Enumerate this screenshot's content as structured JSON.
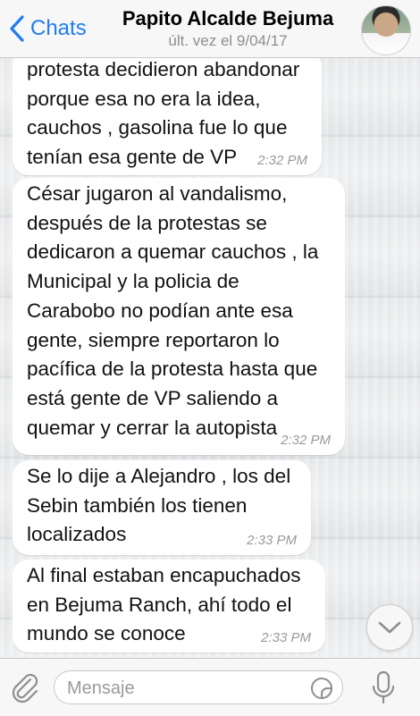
{
  "header": {
    "back_label": "Chats",
    "title": "Papito Alcalde Bejuma",
    "status": "últ. vez el 9/04/17"
  },
  "messages": [
    {
      "text": "protesta decidieron abandonar\nporque esa no era la idea,\ncauchos , gasolina fue lo que\ntenían esa gente de VP",
      "time": "2:32 PM"
    },
    {
      "text": "César jugaron al vandalismo,\ndespués de la protestas se\ndedicaron a quemar cauchos , la\nMunicipal y la policia de\nCarabobo no podían ante esa\ngente, siempre reportaron lo\npacífica de la protesta hasta que\nestá gente de VP saliendo a\nquemar y cerrar la autopista",
      "time": "2:32 PM"
    },
    {
      "text": "Se lo dije a Alejandro , los del\nSebin también los tienen\nlocalizados",
      "time": "2:33 PM"
    },
    {
      "text": "Al final estaban encapuchados\nen Bejuma Ranch, ahí todo el\nmundo se conoce",
      "time": "2:33 PM"
    }
  ],
  "input": {
    "placeholder": "Mensaje"
  },
  "colors": {
    "accent": "#1f7cf1",
    "bubble": "#ffffff",
    "timestamp": "#9a9a9f"
  },
  "icons": {
    "back": "chevron-left-icon",
    "attach": "paperclip-icon",
    "sticker": "sticker-icon",
    "mic": "microphone-icon",
    "scroll": "chevron-down-icon"
  }
}
